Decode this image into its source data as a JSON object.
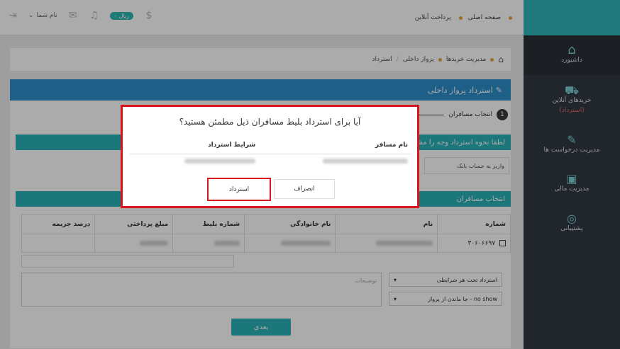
{
  "topbar": {
    "nav": [
      "صفحه اصلی",
      "پرداخت آنلاین"
    ],
    "user_name": "نام شما",
    "currency_badge": "۰ ریال",
    "dollar_icon": "$"
  },
  "sidebar": {
    "items": [
      {
        "label": "داشبورد",
        "sub": ""
      },
      {
        "label": "خریدهای آنلاین",
        "sub": "(استرداد)"
      },
      {
        "label": "مدیریت درخواست ها",
        "sub": ""
      },
      {
        "label": "مدیریت مالی",
        "sub": ""
      },
      {
        "label": "پشتیبانی",
        "sub": ""
      }
    ]
  },
  "breadcrumb": [
    "مدیریت خریدها",
    "پرواز داخلی",
    "استرداد"
  ],
  "page_title": "استرداد پرواز داخلی",
  "step": {
    "number": "1",
    "label": "انتخاب مسافران"
  },
  "refund_method": {
    "header": "لطفا نحوه استرداد وجه را مشخص کنید",
    "option": "واریز به حساب بانک"
  },
  "passengers": {
    "header": "انتخاب مسافران",
    "columns": [
      "شماره",
      "نام",
      "نام خانوادگی",
      "شماره بلیط",
      "مبلغ پرداختی",
      "درصد جریمه"
    ],
    "row_number": "۳۰۶۰۶۶۹۷"
  },
  "notes_placeholder": "توضیحات",
  "select_condition": "استرداد تحت هر شرایطی",
  "select_reason": "no show - جا ماندن از پرواز",
  "next_label": "بعدی",
  "modal": {
    "question": "آیا برای استرداد بلیط مسافران ذیل مطمئن هستید؟",
    "col_passenger": "نام مسافر",
    "col_conditions": "شرایط استرداد",
    "cancel_label": "انصراف",
    "refund_label": "استرداد"
  }
}
